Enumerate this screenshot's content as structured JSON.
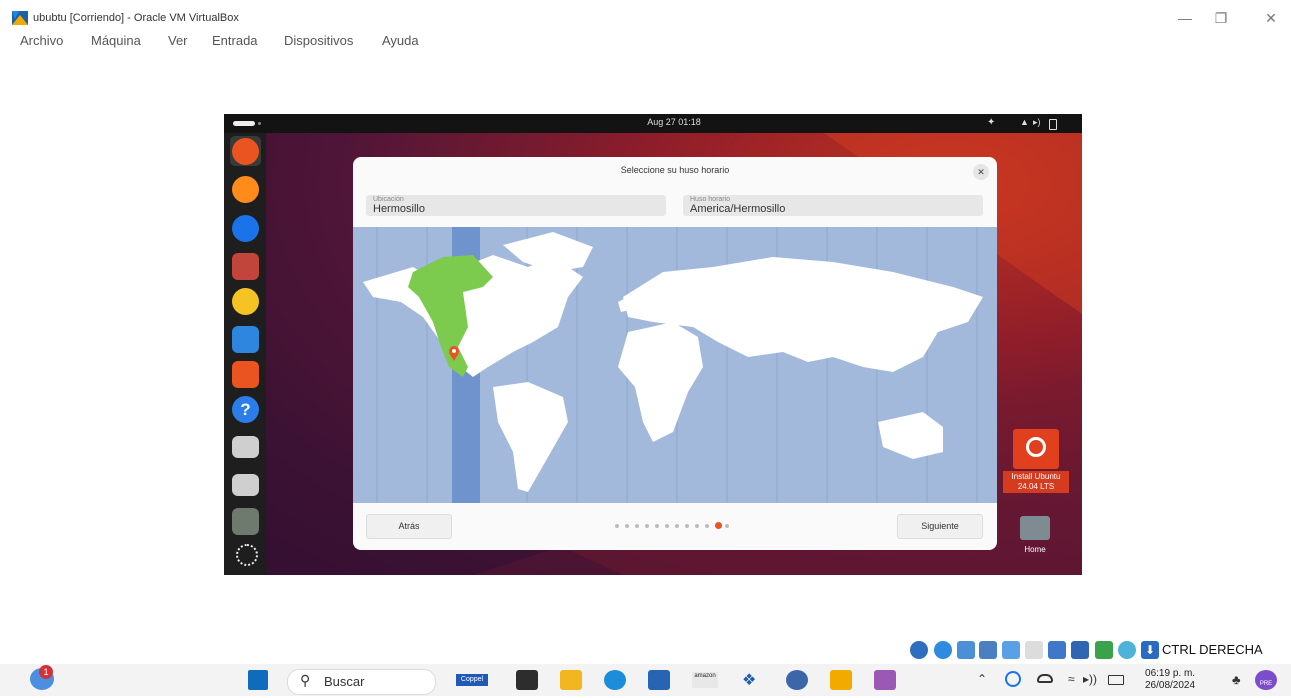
{
  "window": {
    "title": "ububtu [Corriendo] - Oracle VM VirtualBox",
    "controls": [
      "minimize-icon",
      "restore-icon",
      "close-icon"
    ]
  },
  "menubar": {
    "items": [
      {
        "label": "Archivo"
      },
      {
        "label": "Máquina"
      },
      {
        "label": "Ver"
      },
      {
        "label": "Entrada"
      },
      {
        "label": "Dispositivos"
      },
      {
        "label": "Ayuda"
      }
    ]
  },
  "vm": {
    "clock": "Aug 27  01:18",
    "top_icons": [
      "accessibility-icon",
      "network-icon",
      "volume-icon",
      "battery-icon"
    ],
    "dock": [
      "ubuntu-installer-icon",
      "firefox-icon",
      "thunderbird-icon",
      "files-icon",
      "rhythmbox-icon",
      "writer-icon",
      "app-center-icon",
      "help-icon",
      "drive-icon",
      "drive-icon",
      "trash-icon",
      "apps-grid-icon"
    ],
    "dialog": {
      "title": "Seleccione su huso horario",
      "location_label": "Ubicación",
      "location_value": "Hermosillo",
      "timezone_label": "Huso horario",
      "timezone_value": "America/Hermosillo",
      "back_label": "Atrás",
      "next_label": "Siguiente",
      "steps_total": 12,
      "current_step": 11
    },
    "desktop": {
      "install_label": "Install Ubuntu 24.04 LTS",
      "home_label": "Home"
    }
  },
  "statusbar": {
    "host_key": "CTRL DERECHA"
  },
  "taskbar": {
    "notification_badge": "1",
    "search_placeholder": "Buscar",
    "coppel_label": "Coppel",
    "amazon_label": "amazon",
    "time": "06:19 p. m.",
    "date": "26/08/2024",
    "pre_badge": "PRE"
  }
}
